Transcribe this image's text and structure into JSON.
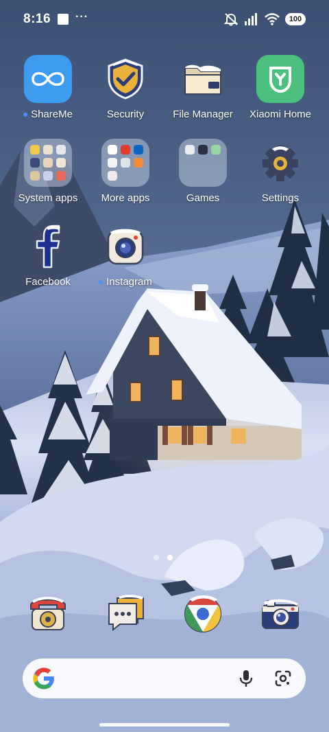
{
  "status_bar": {
    "time": "8:16",
    "more": "···",
    "battery": "100"
  },
  "apps": {
    "shareme": {
      "label": "ShareMe",
      "icon": "shareme-icon",
      "color": "#3d9bf0"
    },
    "security": {
      "label": "Security",
      "icon": "security-shield-icon"
    },
    "file_manager": {
      "label": "File Manager",
      "icon": "folder-icon"
    },
    "xiaomi_home": {
      "label": "Xiaomi Home",
      "icon": "xiaomi-home-icon",
      "color": "#4cc07e"
    },
    "system_apps": {
      "label": "System apps",
      "icon": "folder-system-apps-icon"
    },
    "more_apps": {
      "label": "More apps",
      "icon": "folder-more-apps-icon"
    },
    "games": {
      "label": "Games",
      "icon": "folder-games-icon"
    },
    "settings": {
      "label": "Settings",
      "icon": "gear-icon"
    },
    "facebook": {
      "label": "Facebook",
      "icon": "facebook-icon",
      "color": "#1f2f8f"
    },
    "instagram": {
      "label": "Instagram",
      "icon": "instagram-camera-icon"
    }
  },
  "dock": [
    {
      "name": "phone",
      "icon": "phone-icon"
    },
    {
      "name": "messages",
      "icon": "messages-icon"
    },
    {
      "name": "chrome",
      "icon": "chrome-icon"
    },
    {
      "name": "camera",
      "icon": "camera-icon"
    }
  ],
  "pages": {
    "count": 2,
    "active": 2
  },
  "search": {
    "google_icon": "google-g-icon",
    "mic_icon": "microphone-icon",
    "lens_icon": "google-lens-icon"
  }
}
